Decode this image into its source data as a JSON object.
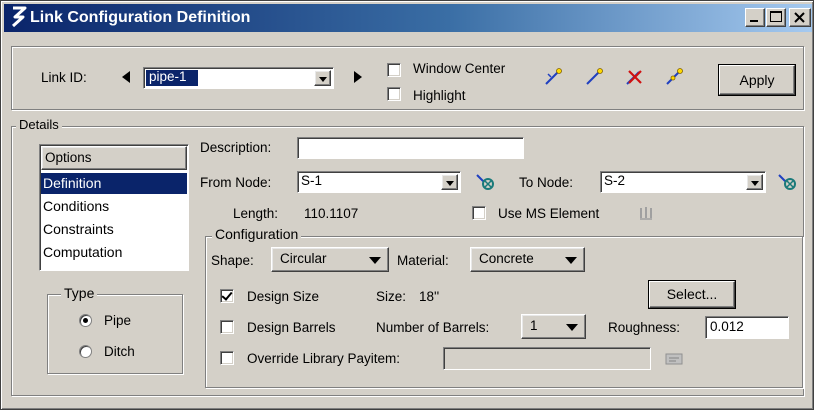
{
  "window": {
    "title": "Link Configuration Definition",
    "minimize_label": "_",
    "close_label": "x"
  },
  "link_id": {
    "label": "Link ID:",
    "value": "pipe-1"
  },
  "options": {
    "window_center_label": "Window Center",
    "window_center_checked": false,
    "highlight_label": "Highlight",
    "highlight_checked": false
  },
  "tool_icons": [
    "link-select-icon",
    "link-add-icon",
    "link-delete-icon",
    "link-edit-icon"
  ],
  "apply_label": "Apply",
  "details": {
    "legend": "Details",
    "options_header": "Options",
    "options_items": [
      "Definition",
      "Conditions",
      "Constraints",
      "Computation"
    ],
    "selected_index": 0
  },
  "type": {
    "legend": "Type",
    "pipe_label": "Pipe",
    "ditch_label": "Ditch",
    "selected": "Pipe"
  },
  "definition": {
    "description_label": "Description:",
    "description_value": "",
    "from_node_label": "From Node:",
    "from_node_value": "S-1",
    "to_node_label": "To Node:",
    "to_node_value": "S-2",
    "length_label": "Length:",
    "length_value": "110.1107",
    "use_ms_label": "Use MS Element",
    "use_ms_checked": false
  },
  "configuration": {
    "legend": "Configuration",
    "shape_label": "Shape:",
    "shape_value": "Circular",
    "material_label": "Material:",
    "material_value": "Concrete",
    "design_size_label": "Design Size",
    "design_size_checked": true,
    "size_label": "Size:",
    "size_value": "18''",
    "select_label": "Select...",
    "design_barrels_label": "Design Barrels",
    "design_barrels_checked": false,
    "num_barrels_label": "Number of Barrels:",
    "num_barrels_value": "1",
    "roughness_label": "Roughness:",
    "roughness_value": "0.012",
    "override_label": "Override Library Payitem:",
    "override_checked": false,
    "override_value": ""
  },
  "colors": {
    "title_bar": "#0a246a",
    "selection": "#0a246a",
    "face": "#d4d0c8"
  }
}
